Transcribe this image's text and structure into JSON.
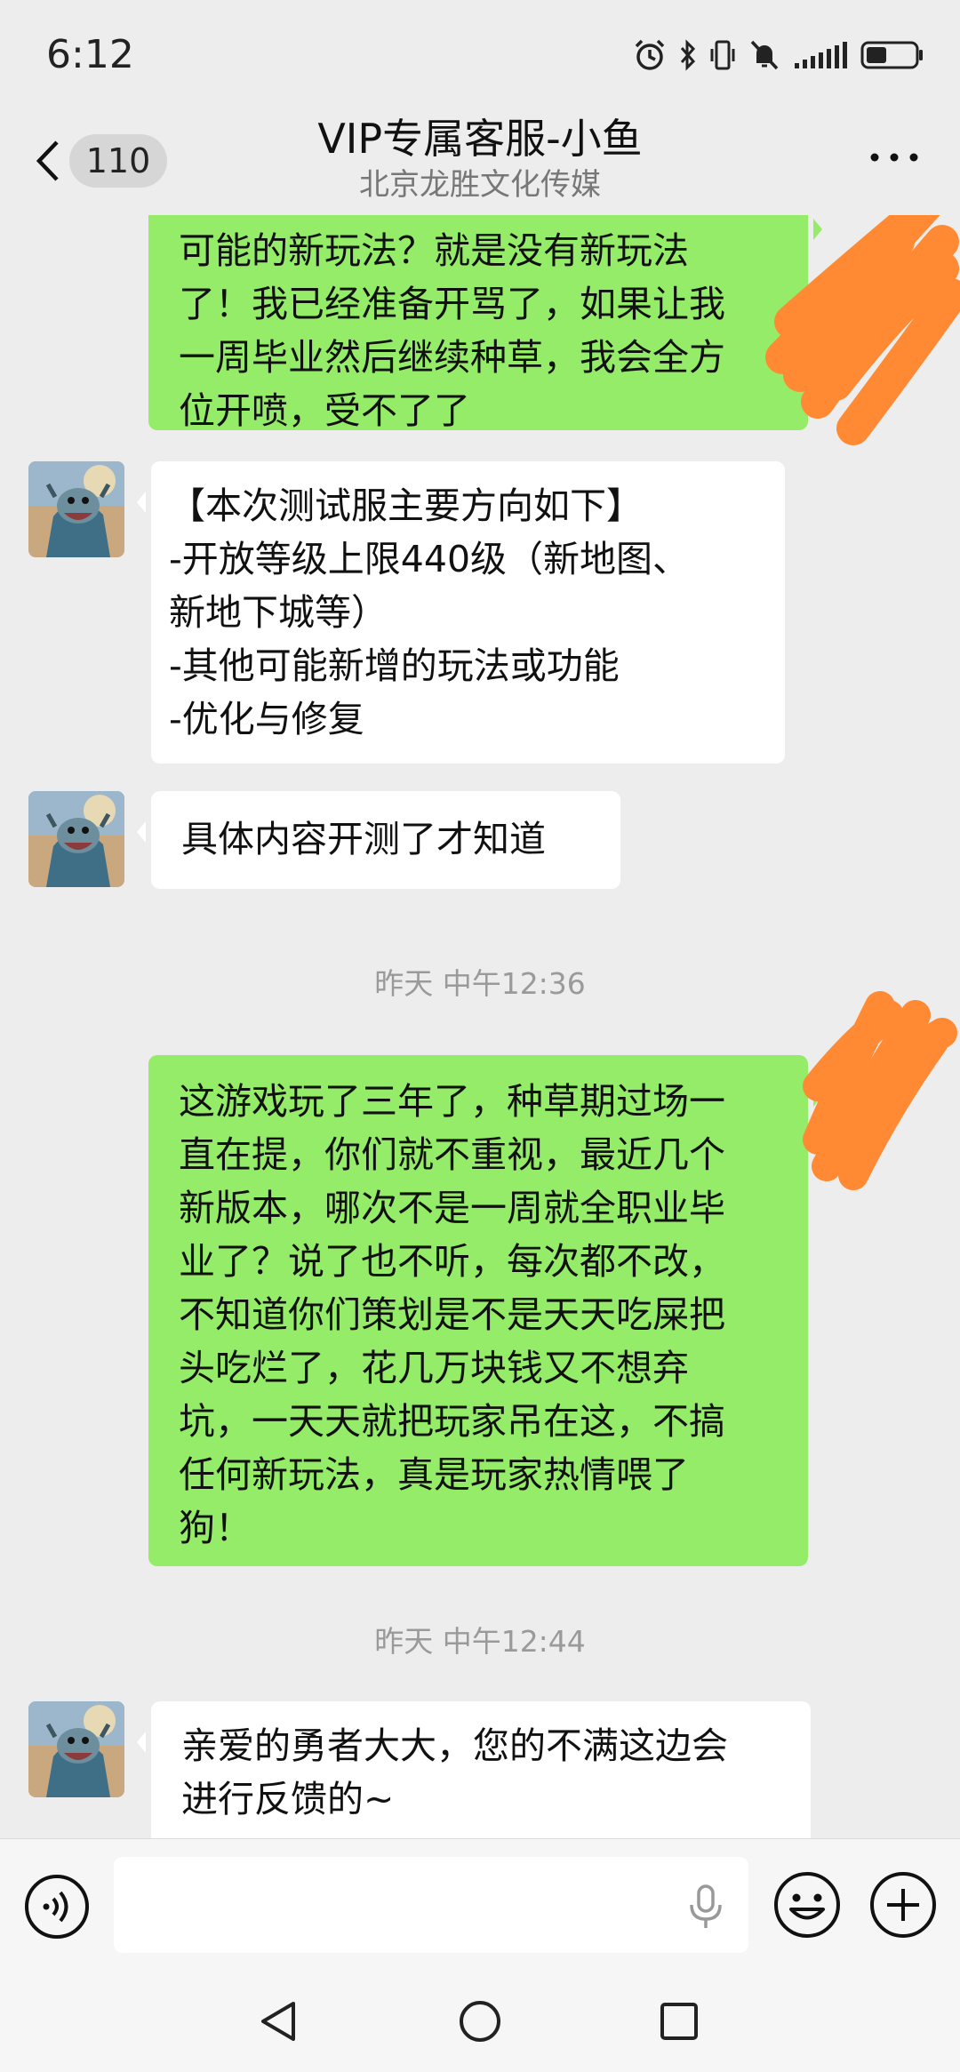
{
  "status_bar": {
    "time": "6:12",
    "icons": [
      "alarm-icon",
      "bluetooth-icon",
      "vibrate-icon",
      "mute-icon",
      "signal-icon",
      "battery-icon"
    ]
  },
  "header": {
    "back_badge": "110",
    "title": "VIP专属客服-小鱼",
    "subtitle": "北京龙胜文化传媒"
  },
  "messages": [
    {
      "side": "out",
      "text": "可能的新玩法？就是没有新玩法\n了！我已经准备开骂了，如果让我\n一周毕业然后继续种草，我会全方\n位开喷，受不了了"
    },
    {
      "side": "in",
      "text": "【本次测试服主要方向如下】\n-开放等级上限440级（新地图、\n新地下城等）\n-其他可能新增的玩法或功能\n-优化与修复"
    },
    {
      "side": "in",
      "text": "具体内容开测了才知道"
    },
    {
      "timestamp": "昨天 中午12:36"
    },
    {
      "side": "out",
      "text": "这游戏玩了三年了，种草期过场一\n直在提，你们就不重视，最近几个\n新版本，哪次不是一周就全职业毕\n业了？说了也不听，每次都不改，\n不知道你们策划是不是天天吃屎把\n头吃烂了，花几万块钱又不想弃\n坑，一天天就把玩家吊在这，不搞\n任何新玩法，真是玩家热情喂了\n狗！"
    },
    {
      "timestamp": "昨天 中午12:44"
    },
    {
      "side": "in",
      "text": "亲爱的勇者大大，您的不满这边会\n进行反馈的~"
    }
  ],
  "input": {
    "placeholder": ""
  },
  "colors": {
    "background": "#ededed",
    "outgoing_bubble": "#95ec69",
    "incoming_bubble": "#ffffff",
    "scribble": "#ff8a33"
  },
  "nav": {
    "icons": [
      "back-triangle-icon",
      "home-circle-icon",
      "recents-square-icon"
    ]
  }
}
